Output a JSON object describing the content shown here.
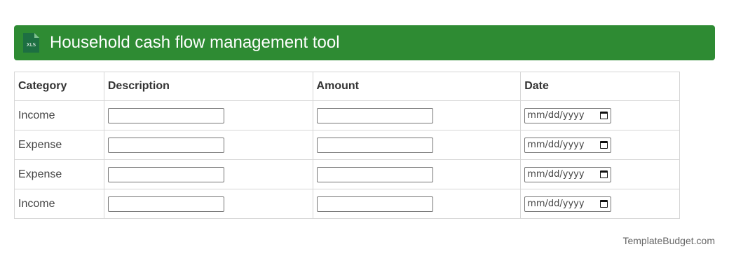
{
  "colors": {
    "header_bg": "#2e8b33",
    "header_text": "#ffffff",
    "icon_green": "#1d6f42"
  },
  "header": {
    "icon": "xls-file-icon",
    "icon_label": "XLS",
    "title": "Household cash flow management tool"
  },
  "table": {
    "columns": [
      "Category",
      "Description",
      "Amount",
      "Date"
    ],
    "rows": [
      {
        "category": "Income",
        "description": "",
        "amount": "",
        "date_placeholder": "mm/dd/yyyy"
      },
      {
        "category": "Expense",
        "description": "",
        "amount": "",
        "date_placeholder": "mm/dd/yyyy"
      },
      {
        "category": "Expense",
        "description": "",
        "amount": "",
        "date_placeholder": "mm/dd/yyyy"
      },
      {
        "category": "Income",
        "description": "",
        "amount": "",
        "date_placeholder": "mm/dd/yyyy"
      }
    ]
  },
  "footer": {
    "credit": "TemplateBudget.com"
  }
}
